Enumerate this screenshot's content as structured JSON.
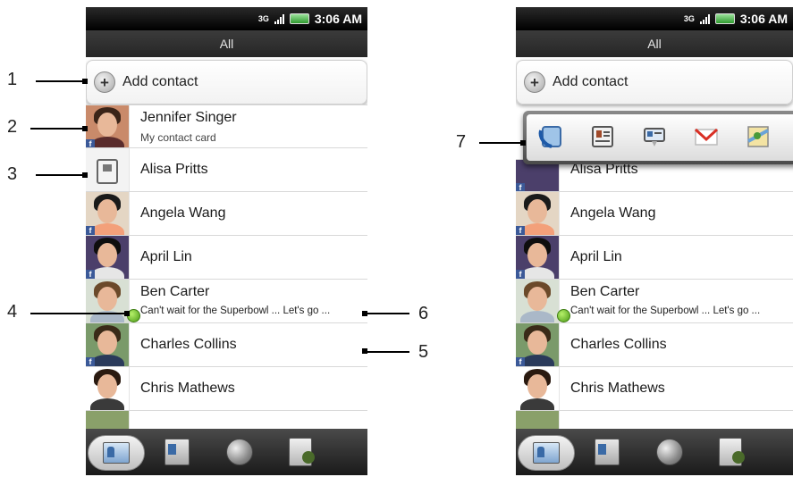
{
  "status": {
    "network": "3G",
    "time": "3:06 AM"
  },
  "header": {
    "title": "All"
  },
  "add_contact_label": "Add contact",
  "contacts": [
    {
      "name": "Jennifer Singer",
      "sub": "My contact card"
    },
    {
      "name": "Alisa Pritts"
    },
    {
      "name": "Angela Wang"
    },
    {
      "name": "April  Lin"
    },
    {
      "name": "Ben  Carter",
      "status": "Can't wait for the Superbowl ... Let's go ..."
    },
    {
      "name": "Charles  Collins"
    },
    {
      "name": "Chris Mathews"
    }
  ],
  "right_partial_contact": "Alisa Pritts",
  "tabs": [
    "people-icon",
    "groups-icon",
    "online-directory-icon",
    "call-history-icon"
  ],
  "popup_icons": [
    "call-icon",
    "contact-card-icon",
    "message-icon",
    "gmail-icon",
    "map-icon"
  ],
  "callouts": [
    "1",
    "2",
    "3",
    "4",
    "5",
    "6",
    "7"
  ],
  "colors": {
    "facebook": "#3b5998",
    "status_green": "#6cc32a"
  }
}
